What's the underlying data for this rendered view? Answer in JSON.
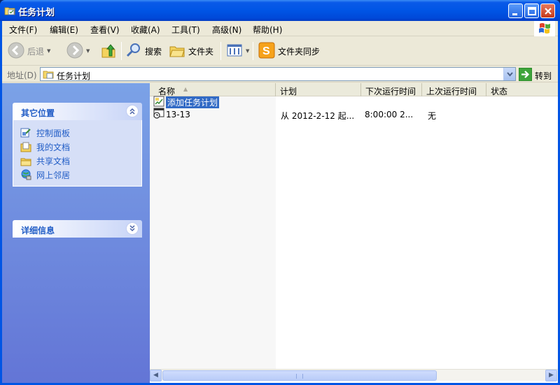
{
  "window": {
    "title": "任务计划"
  },
  "menu": [
    "文件(F)",
    "编辑(E)",
    "查看(V)",
    "收藏(A)",
    "工具(T)",
    "高级(N)",
    "帮助(H)"
  ],
  "toolbar": {
    "back": "后退",
    "search": "搜索",
    "folders": "文件夹",
    "folder_sync": "文件夹同步"
  },
  "address": {
    "label": "地址(D)",
    "value": "任务计划",
    "go": "转到"
  },
  "left_panels": [
    {
      "title": "其它位置",
      "links": [
        "控制面板",
        "我的文档",
        "共享文档",
        "网上邻居"
      ]
    },
    {
      "title": "详细信息"
    }
  ],
  "columns": [
    "名称",
    "计划",
    "下次运行时间",
    "上次运行时间",
    "状态"
  ],
  "rows": [
    {
      "name": "添加任务计划",
      "schedule": "",
      "next_run": "",
      "last_run": "",
      "status": "",
      "selected": true
    },
    {
      "name": "13-13",
      "schedule": "从 2012-2-12 起...",
      "next_run": "8:00:00  2...",
      "last_run": "无",
      "status": ""
    }
  ],
  "colors": {
    "titlebar": "#0055e5",
    "link": "#215dc6",
    "selection": "#316ac5",
    "pane_gradient_top": "#7ba2e7"
  }
}
